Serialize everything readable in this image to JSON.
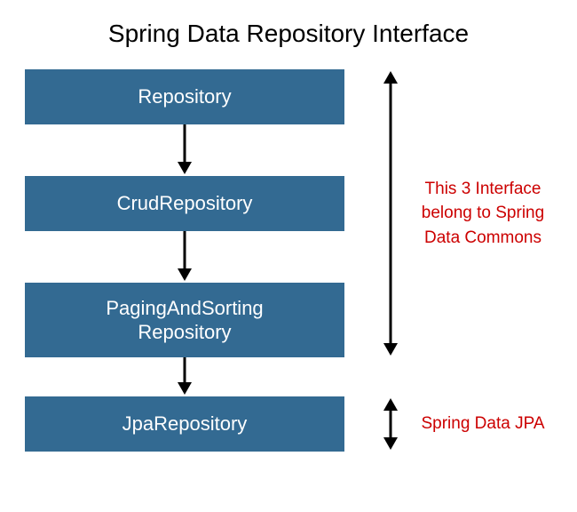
{
  "title": "Spring Data Repository Interface",
  "boxes": {
    "b1": "Repository",
    "b2": "CrudRepository",
    "b3_line1": "PagingAndSorting",
    "b3_line2": "Repository",
    "b4": "JpaRepository"
  },
  "annotations": {
    "commons_line1": "This 3 Interface",
    "commons_line2": "belong to Spring",
    "commons_line3": "Data Commons",
    "jpa": "Spring Data JPA"
  },
  "colors": {
    "box_bg": "#336a92",
    "box_text": "#ffffff",
    "annotation": "#cc0000",
    "title": "#000000"
  }
}
